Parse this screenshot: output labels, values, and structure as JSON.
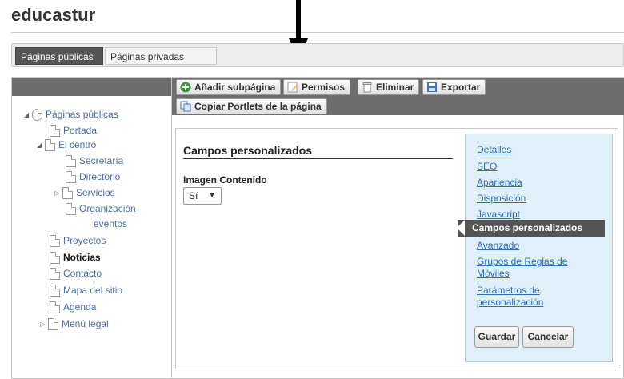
{
  "site": {
    "title": "educastur"
  },
  "tabs": [
    {
      "label": "Páginas públicas"
    },
    {
      "label": "Páginas privadas"
    }
  ],
  "toolbar": {
    "add_subpage": "Añadir subpágina",
    "permissions": "Permisos",
    "delete": "Eliminar",
    "export": "Exportar",
    "copy_portlets": "Copiar Portlets de la página"
  },
  "tree": {
    "root": "Páginas públicas",
    "items": [
      {
        "label": "Portada"
      },
      {
        "label": "El centro"
      },
      {
        "label": "Secretaría"
      },
      {
        "label": "Directorio"
      },
      {
        "label": "Servicios"
      },
      {
        "label": "Organización"
      },
      {
        "label": "eventos"
      },
      {
        "label": "Proyectos"
      },
      {
        "label": "Noticias"
      },
      {
        "label": "Contacto"
      },
      {
        "label": "Mapa del sitio"
      },
      {
        "label": "Agenda"
      },
      {
        "label": "Menú legal"
      }
    ]
  },
  "form": {
    "title": "Campos personalizados",
    "field_label": "Imagen Contenido",
    "field_value": "Sí"
  },
  "side_nav": {
    "links": [
      "Detalles",
      "SEO",
      "Apariencia",
      "Disposición",
      "Javascript",
      "Campos personalizados",
      "Avanzado",
      "Grupos de Reglas de",
      "Móviles",
      "Parámetros de",
      "personalización"
    ],
    "active_index": 5,
    "save": "Guardar",
    "cancel": "Cancelar"
  },
  "colors": {
    "link": "#2a6ebb",
    "active_bg": "#555555",
    "panel_bg": "#dff0f8",
    "toolbar_bg": "#6d6d6d"
  }
}
